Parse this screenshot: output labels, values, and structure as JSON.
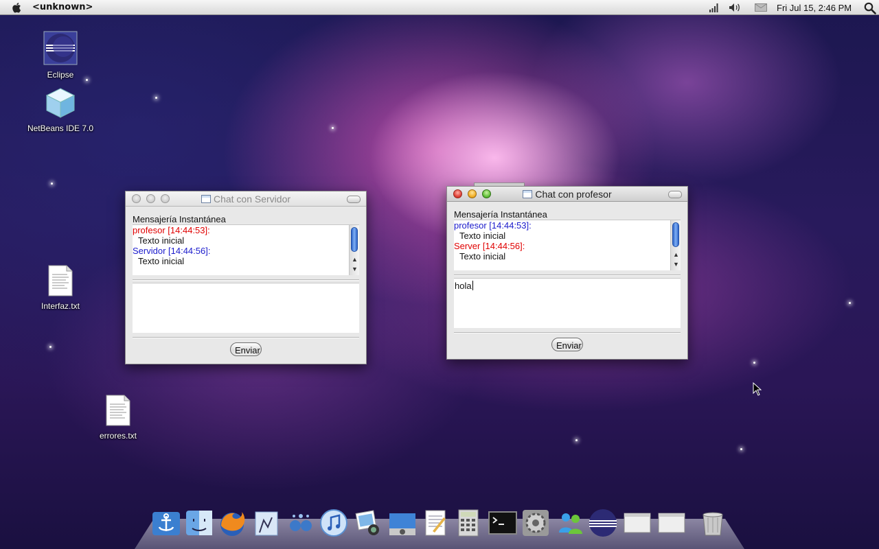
{
  "menubar": {
    "app_name": "<unknown>",
    "clock": "Fri Jul 15,  2:46 PM",
    "icons": [
      "apple-icon",
      "signal-icon",
      "volume-icon",
      "mail-icon",
      "spotlight-icon"
    ]
  },
  "desktop_icons": {
    "eclipse": "Eclipse",
    "netbeans": "NetBeans IDE 7.0",
    "interfaz": "Interfaz.txt",
    "errores": "errores.txt"
  },
  "window_server": {
    "title": "Chat con Servidor",
    "section_label": "Mensajería Instantánea",
    "log": [
      {
        "sender": "profesor [14:44:53]:",
        "color": "#e00000",
        "message": "Texto inicial"
      },
      {
        "sender": "Servidor [14:44:56]:",
        "color": "#1a1acc",
        "message": "Texto inicial"
      }
    ],
    "input_value": "",
    "send_label": "Enviar"
  },
  "window_profesor": {
    "title": "Chat con profesor",
    "section_label": "Mensajería Instantánea",
    "log": [
      {
        "sender": "profesor [14:44:53]:",
        "color": "#1a1acc",
        "message": "Texto inicial"
      },
      {
        "sender": "Server [14:44:56]:",
        "color": "#e00000",
        "message": "Texto inicial"
      }
    ],
    "input_value": "hola",
    "send_label": "Enviar"
  },
  "dock": {
    "items": [
      "anchor",
      "finder",
      "firefox",
      "mail",
      "dashboard",
      "itunes",
      "iphoto",
      "image-capture",
      "textedit",
      "calculator",
      "terminal",
      "system-preferences",
      "messenger",
      "eclipse",
      "window-1",
      "window-2",
      "trash"
    ]
  },
  "colors": {
    "sender_red": "#e00000",
    "sender_blue": "#1a1acc"
  }
}
